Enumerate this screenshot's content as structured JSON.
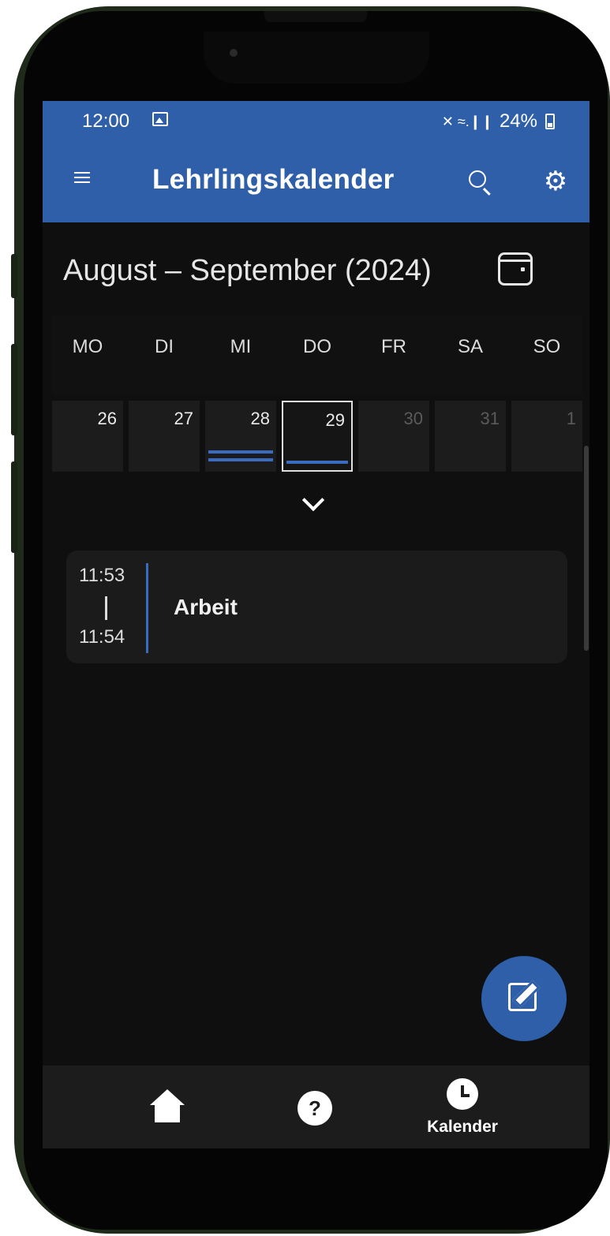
{
  "status_bar": {
    "time": "12:00",
    "signal_text": "✕ ≈.❙❙",
    "battery": "24%"
  },
  "app_bar": {
    "title": "Lehrlingskalender",
    "menu_icon": "menu-icon",
    "search_icon": "search-icon",
    "settings_icon": "gear-icon",
    "color": "#2f5fa8"
  },
  "calendar": {
    "range_title": "August – September (2024)",
    "weekdays": [
      "MO",
      "DI",
      "MI",
      "DO",
      "FR",
      "SA",
      "SO"
    ],
    "days": [
      {
        "num": "26",
        "dim": false,
        "events": 0,
        "selected": false
      },
      {
        "num": "27",
        "dim": false,
        "events": 0,
        "selected": false
      },
      {
        "num": "28",
        "dim": false,
        "events": 2,
        "selected": false
      },
      {
        "num": "29",
        "dim": false,
        "events": 1,
        "selected": true
      },
      {
        "num": "30",
        "dim": true,
        "events": 0,
        "selected": false
      },
      {
        "num": "31",
        "dim": true,
        "events": 0,
        "selected": false
      },
      {
        "num": "1",
        "dim": true,
        "events": 0,
        "selected": false
      }
    ]
  },
  "events": [
    {
      "start": "11:53",
      "end": "11:54",
      "title": "Arbeit"
    }
  ],
  "bottom_nav": {
    "items": [
      {
        "icon": "home-icon",
        "label": ""
      },
      {
        "icon": "help-icon",
        "label": ""
      },
      {
        "icon": "clock-icon",
        "label": "Kalender"
      }
    ]
  },
  "fab": {
    "icon": "edit-icon"
  },
  "accent_color": "#3a6bc0"
}
